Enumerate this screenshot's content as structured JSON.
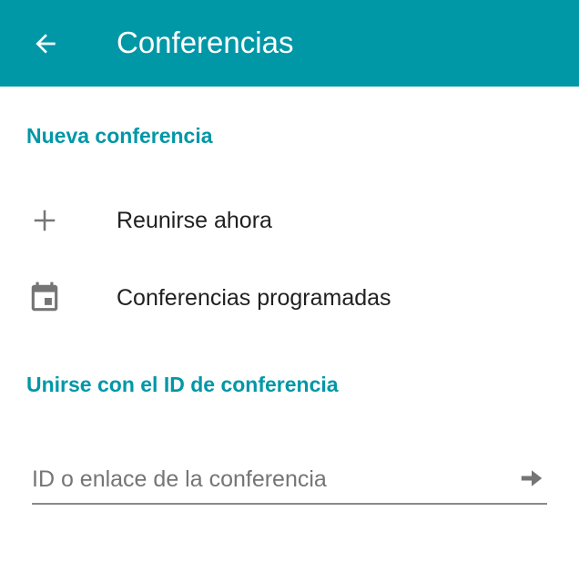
{
  "appbar": {
    "title": "Conferencias",
    "back_icon": "arrow-back-icon",
    "background_color": "#0097a7"
  },
  "new_conference": {
    "header": "Nueva conferencia",
    "items": [
      {
        "icon": "plus-icon",
        "label": "Reunirse ahora"
      },
      {
        "icon": "calendar-icon",
        "label": "Conferencias programadas"
      }
    ]
  },
  "join": {
    "header": "Unirse con el ID de conferencia",
    "input_value": "",
    "input_placeholder": "ID o enlace de la conferencia",
    "submit_icon": "arrow-forward-icon"
  },
  "colors": {
    "accent": "#0097a7",
    "icon": "#757575",
    "text": "#212121"
  }
}
